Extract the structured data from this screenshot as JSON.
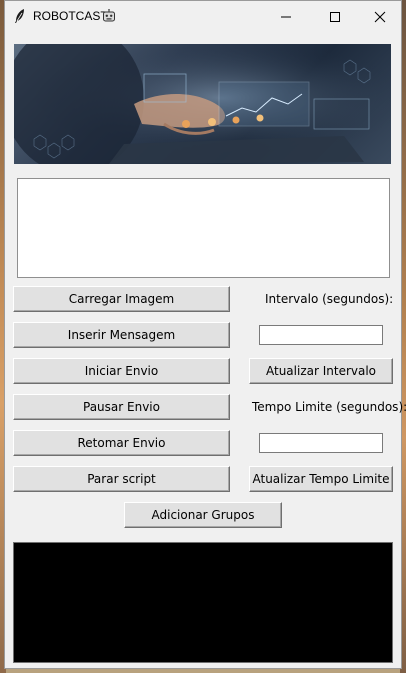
{
  "window": {
    "title": "ROBOTCAST",
    "title_emoji_icon": "robot-face-icon",
    "app_icon": "feather-icon",
    "controls": [
      "minimize-icon",
      "maximize-icon",
      "close-icon"
    ]
  },
  "banner": {
    "image": "hands-on-laptop-tech-overlay"
  },
  "message_box": {
    "value": ""
  },
  "left_buttons": {
    "load_image": "Carregar Imagem",
    "insert_message": "Inserir Mensagem",
    "start_send": "Iniciar Envio",
    "pause_send": "Pausar Envio",
    "resume_send": "Retomar Envio",
    "stop_script": "Parar script"
  },
  "interval": {
    "label": "Intervalo (segundos):",
    "value": "",
    "update_button": "Atualizar Intervalo"
  },
  "time_limit": {
    "label": "Tempo Limite (segundos):",
    "value": "",
    "update_button": "Atualizar Tempo Limite"
  },
  "add_groups_button": "Adicionar Grupos",
  "log_console": {
    "value": ""
  },
  "colors": {
    "window_bg": "#f0f0f0",
    "button_bg": "#e1e1e1",
    "console_bg": "#000000"
  }
}
